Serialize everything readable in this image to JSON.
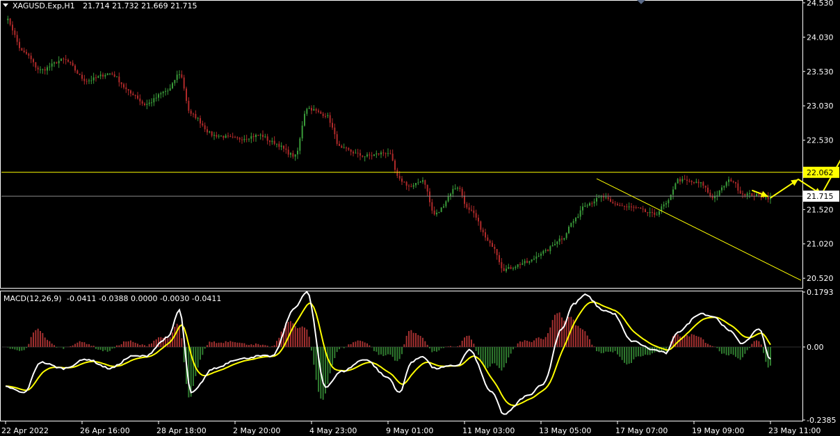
{
  "main_header": {
    "symbol": "XAGUSD.Exp,H1",
    "ohlc": "21.714 21.732 21.669 21.715"
  },
  "macd_header": {
    "name": "MACD(12,26,9)",
    "values": "-0.0411 -0.0388 0.0000 -0.0030 -0.0411"
  },
  "price_axis": {
    "labels": [
      "24.530",
      "24.030",
      "23.530",
      "23.030",
      "22.530",
      "21.520",
      "21.020",
      "20.520"
    ]
  },
  "macd_axis": {
    "labels": [
      "0.1793",
      "0.00",
      "-0.2385"
    ]
  },
  "time_axis": {
    "labels": [
      "22 Apr 2022",
      "26 Apr 16:00",
      "28 Apr 18:00",
      "2 May 20:00",
      "4 May 23:00",
      "9 May 01:00",
      "11 May 03:00",
      "13 May 05:00",
      "17 May 07:00",
      "19 May 09:00",
      "23 May 11:00"
    ]
  },
  "levels": {
    "resistance_label": "22.062",
    "current_label": "21.715"
  },
  "colors": {
    "background": "#000000",
    "bull_candle": "#3a9b3a",
    "bear_candle": "#b02a2a",
    "level_line": "#ffff00",
    "current_line": "#8c8c8c",
    "arrow": "#ffff00",
    "macd_line": "#ffffff",
    "signal_line": "#ffff00",
    "hist_pos": "#a33030",
    "hist_neg": "#2f7a2f",
    "axis_text": "#ffffff",
    "frame": "#ffffff"
  },
  "chart_data": [
    {
      "type": "candlestick",
      "series_name": "XAGUSD.Exp,H1",
      "ylim": [
        20.4,
        24.55
      ],
      "ticks": [
        24.53,
        24.03,
        23.53,
        23.03,
        22.53,
        21.52,
        21.02,
        20.52
      ],
      "anchors": [
        [
          0,
          24.3
        ],
        [
          8,
          23.8
        ],
        [
          15,
          23.55
        ],
        [
          25,
          23.7
        ],
        [
          35,
          23.4
        ],
        [
          45,
          23.5
        ],
        [
          55,
          23.2
        ],
        [
          60,
          23.05
        ],
        [
          70,
          23.25
        ],
        [
          75,
          23.5
        ],
        [
          80,
          22.9
        ],
        [
          90,
          22.6
        ],
        [
          100,
          22.55
        ],
        [
          110,
          22.6
        ],
        [
          115,
          22.5
        ],
        [
          125,
          22.3
        ],
        [
          130,
          23.0
        ],
        [
          138,
          22.9
        ],
        [
          145,
          22.4
        ],
        [
          155,
          22.3
        ],
        [
          165,
          22.35
        ],
        [
          170,
          21.95
        ],
        [
          175,
          21.85
        ],
        [
          180,
          21.95
        ],
        [
          185,
          21.45
        ],
        [
          195,
          21.85
        ],
        [
          200,
          21.5
        ],
        [
          210,
          21.0
        ],
        [
          215,
          20.65
        ],
        [
          225,
          20.75
        ],
        [
          232,
          20.9
        ],
        [
          240,
          21.1
        ],
        [
          245,
          21.35
        ],
        [
          250,
          21.6
        ],
        [
          258,
          21.7
        ],
        [
          262,
          21.6
        ],
        [
          270,
          21.55
        ],
        [
          280,
          21.45
        ],
        [
          285,
          21.6
        ],
        [
          290,
          21.95
        ],
        [
          300,
          21.9
        ],
        [
          305,
          21.7
        ],
        [
          313,
          21.95
        ],
        [
          318,
          21.75
        ],
        [
          325,
          21.72
        ],
        [
          330,
          21.69
        ]
      ],
      "resistance_level": 22.062,
      "current_price": 21.715,
      "trendline": {
        "from": [
          255,
          21.97
        ],
        "to": [
          385,
          20.49
        ]
      },
      "projection_arrow": [
        [
          330,
          21.69
        ],
        [
          342,
          21.96
        ],
        [
          352,
          21.74
        ],
        [
          365,
          22.53
        ]
      ]
    },
    {
      "type": "macd",
      "name": "MACD(12,26,9)",
      "ylim": [
        -0.2385,
        0.1793
      ],
      "ticks": [
        0.1793,
        0.0,
        -0.2385
      ],
      "macd_anchors": [
        [
          0,
          -0.13
        ],
        [
          8,
          -0.15
        ],
        [
          15,
          -0.05
        ],
        [
          25,
          -0.07
        ],
        [
          35,
          -0.04
        ],
        [
          45,
          -0.07
        ],
        [
          55,
          -0.03
        ],
        [
          60,
          -0.03
        ],
        [
          70,
          0.03
        ],
        [
          75,
          0.12
        ],
        [
          80,
          -0.15
        ],
        [
          90,
          -0.07
        ],
        [
          100,
          -0.04
        ],
        [
          110,
          -0.03
        ],
        [
          115,
          -0.03
        ],
        [
          125,
          0.13
        ],
        [
          130,
          0.18
        ],
        [
          138,
          -0.13
        ],
        [
          145,
          -0.08
        ],
        [
          155,
          -0.04
        ],
        [
          165,
          -0.1
        ],
        [
          170,
          -0.15
        ],
        [
          175,
          -0.05
        ],
        [
          180,
          -0.03
        ],
        [
          185,
          -0.07
        ],
        [
          195,
          -0.06
        ],
        [
          200,
          -0.01
        ],
        [
          210,
          -0.15
        ],
        [
          215,
          -0.22
        ],
        [
          225,
          -0.16
        ],
        [
          232,
          -0.12
        ],
        [
          240,
          0.06
        ],
        [
          245,
          0.14
        ],
        [
          250,
          0.17
        ],
        [
          258,
          0.12
        ],
        [
          262,
          0.11
        ],
        [
          270,
          0.02
        ],
        [
          280,
          -0.01
        ],
        [
          285,
          -0.02
        ],
        [
          290,
          0.05
        ],
        [
          300,
          0.11
        ],
        [
          305,
          0.1
        ],
        [
          313,
          0.05
        ],
        [
          318,
          0.01
        ],
        [
          325,
          0.06
        ],
        [
          330,
          -0.04
        ]
      ],
      "signal_period": 9,
      "last": {
        "macd": -0.0411,
        "signal": -0.0388
      }
    }
  ]
}
